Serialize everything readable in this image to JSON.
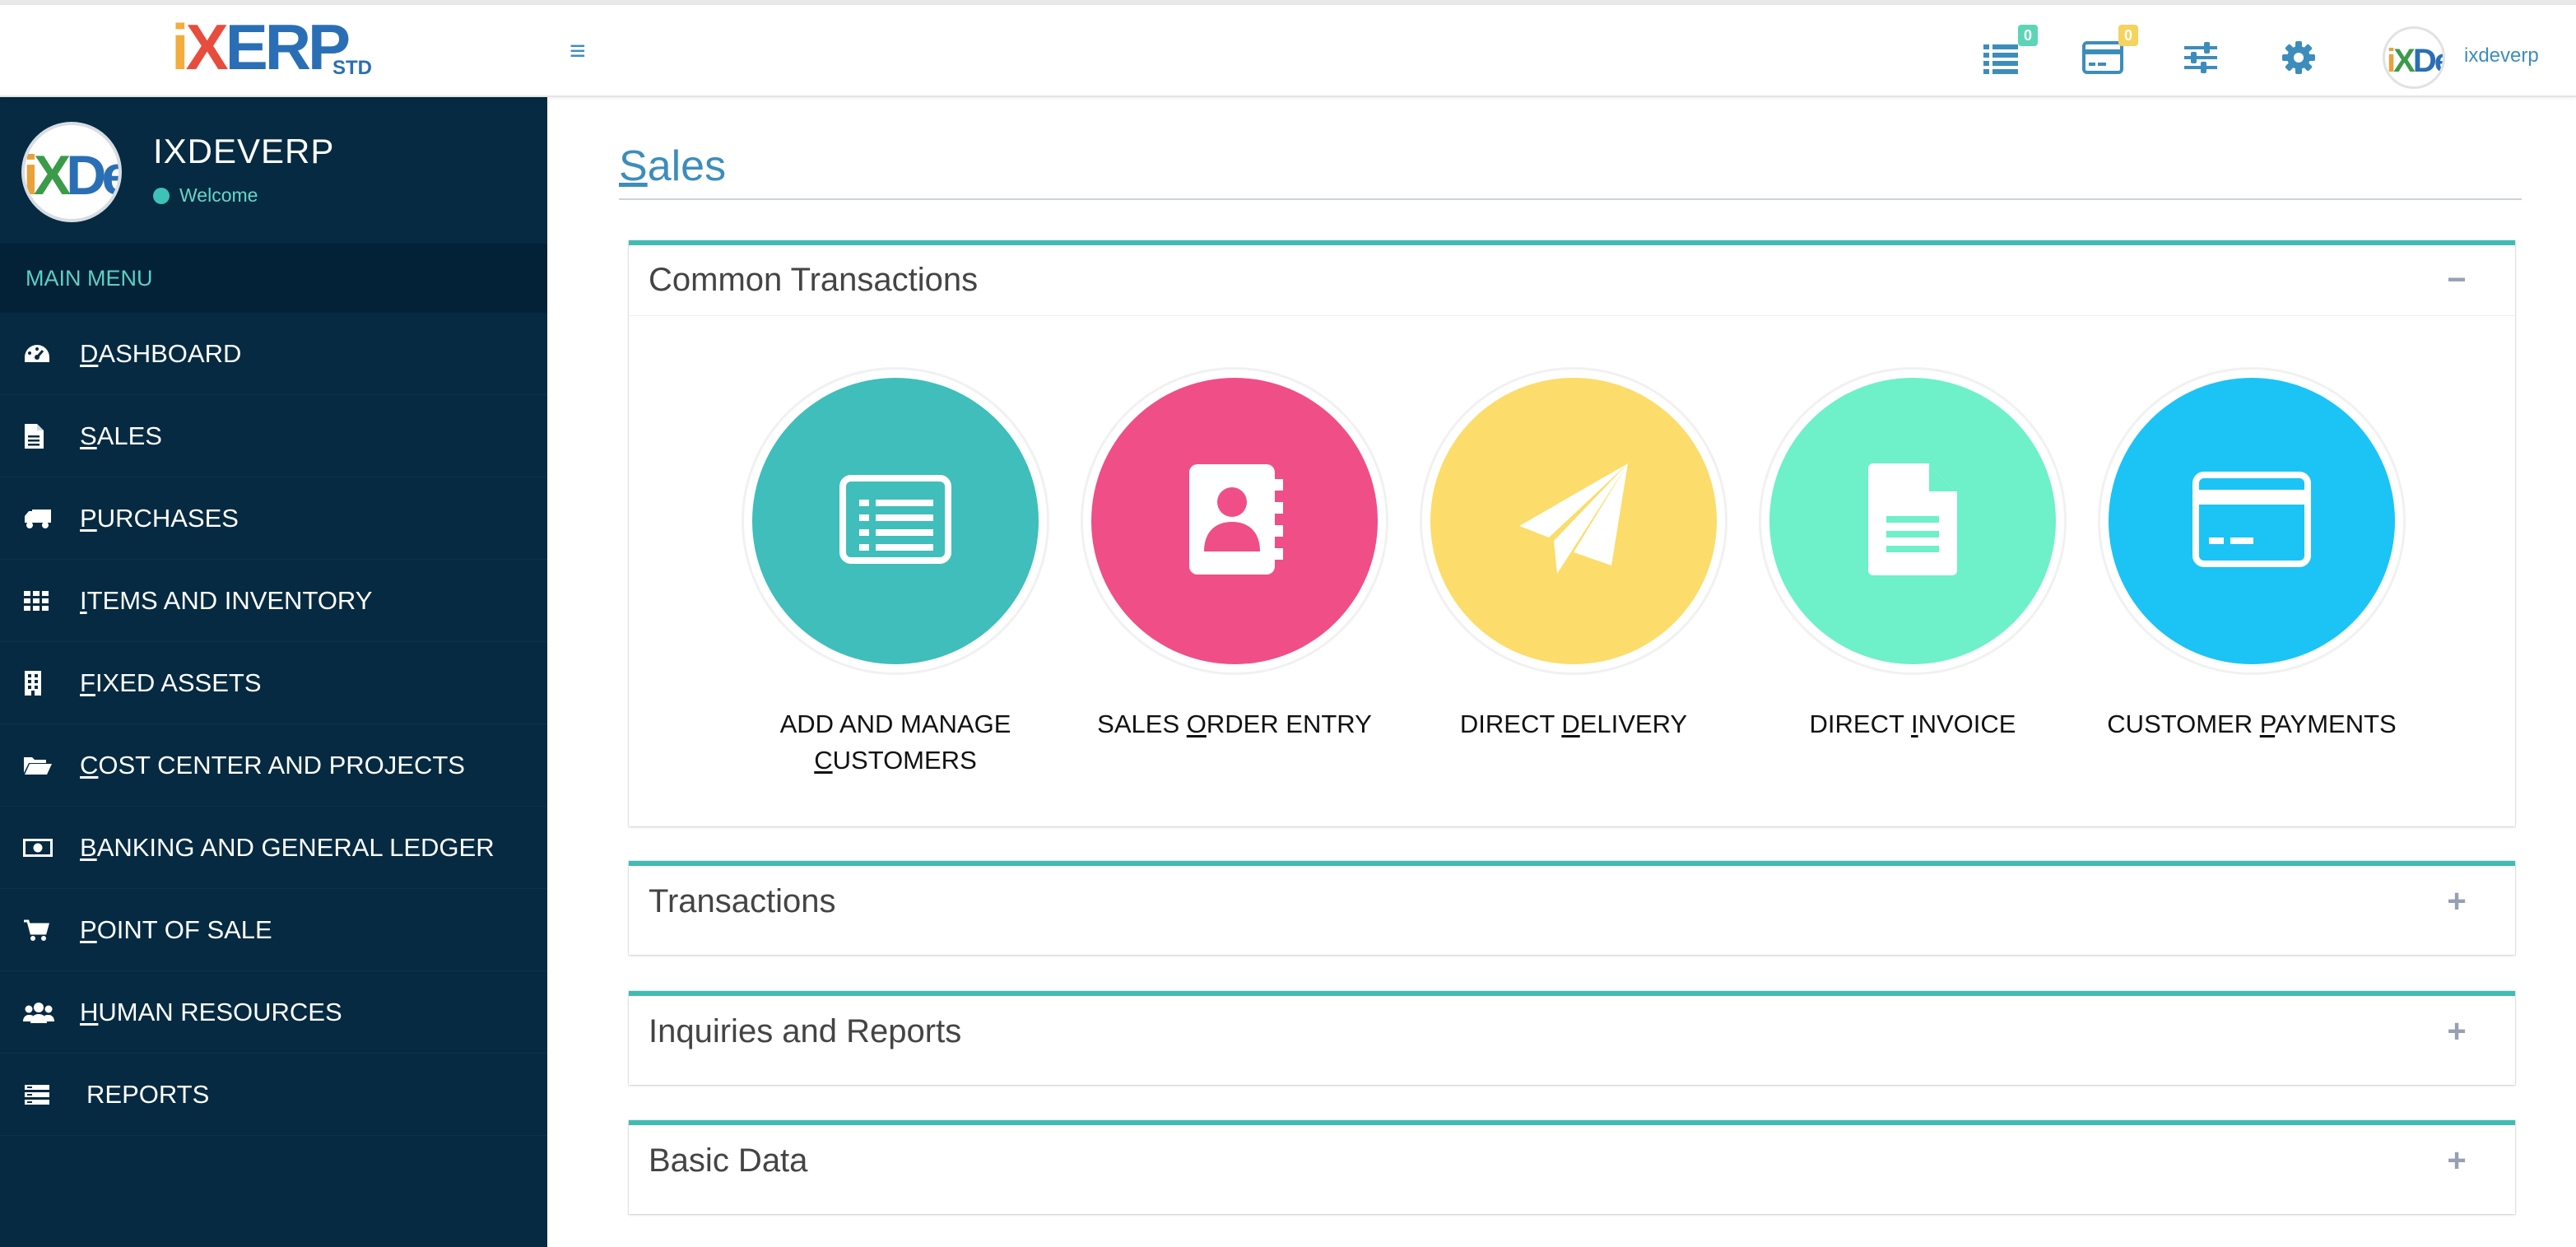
{
  "topbar": {
    "logo_text": "iXERP",
    "logo_sub": "STD",
    "hamburger_icon": "bars-icon",
    "icons": [
      {
        "name": "list-icon",
        "badge": "0",
        "badge_color": "#5cd5b6"
      },
      {
        "name": "credit-card-icon",
        "badge": "0",
        "badge_color": "#f4d35e"
      },
      {
        "name": "sliders-icon",
        "badge": ""
      },
      {
        "name": "gear-icon",
        "badge": ""
      }
    ],
    "user_name": "ixdeverp"
  },
  "sidebar": {
    "profile_name": "IXDEVERP",
    "profile_status": "Welcome",
    "menu_header": "MAIN MENU",
    "items": [
      {
        "key": "D",
        "rest": "ASHBOARD",
        "icon": "tachometer-icon"
      },
      {
        "key": "S",
        "rest": "ALES",
        "icon": "file-icon"
      },
      {
        "key": "P",
        "rest": "URCHASES",
        "icon": "truck-icon"
      },
      {
        "key": "I",
        "rest": "TEMS AND INVENTORY",
        "icon": "grid-icon"
      },
      {
        "key": "F",
        "rest": "IXED ASSETS",
        "icon": "building-icon"
      },
      {
        "key": "C",
        "rest": "OST CENTER AND PROJECTS",
        "icon": "folder-open-icon"
      },
      {
        "key": "B",
        "rest": "ANKING AND GENERAL LEDGER",
        "icon": "money-icon"
      },
      {
        "key": "P",
        "rest": "OINT OF SALE",
        "icon": "cart-icon"
      },
      {
        "key": "H",
        "rest": "UMAN RESOURCES",
        "icon": "users-icon"
      },
      {
        "key": "",
        "rest": "REPORTS",
        "icon": "reports-icon"
      }
    ]
  },
  "main": {
    "title_key": "S",
    "title_rest": "ales",
    "panels": [
      {
        "title": "Common Transactions",
        "toggle": "−"
      },
      {
        "title": "Transactions",
        "toggle": "+"
      },
      {
        "title": "Inquiries and Reports",
        "toggle": "+"
      },
      {
        "title": "Basic Data",
        "toggle": "+"
      }
    ],
    "tiles": [
      {
        "line1": "ADD AND MANAGE",
        "pre": "",
        "key": "C",
        "post": "USTOMERS",
        "color": "#3fbebb",
        "icon": "list-alt-icon"
      },
      {
        "line1": "",
        "pre": "SALES ",
        "key": "O",
        "post": "RDER ENTRY",
        "color": "#f04e86",
        "icon": "address-book-icon"
      },
      {
        "line1": "",
        "pre": "DIRECT ",
        "key": "D",
        "post": "ELIVERY",
        "color": "#fcdc6a",
        "icon": "paper-plane-icon"
      },
      {
        "line1": "",
        "pre": "DIRECT ",
        "key": "I",
        "post": "NVOICE",
        "color": "#6ef0c9",
        "icon": "file-text-icon"
      },
      {
        "line1": "",
        "pre": "CUSTOMER ",
        "key": "P",
        "post": "AYMENTS",
        "color": "#1cc3f5",
        "icon": "credit-card-icon"
      }
    ]
  }
}
